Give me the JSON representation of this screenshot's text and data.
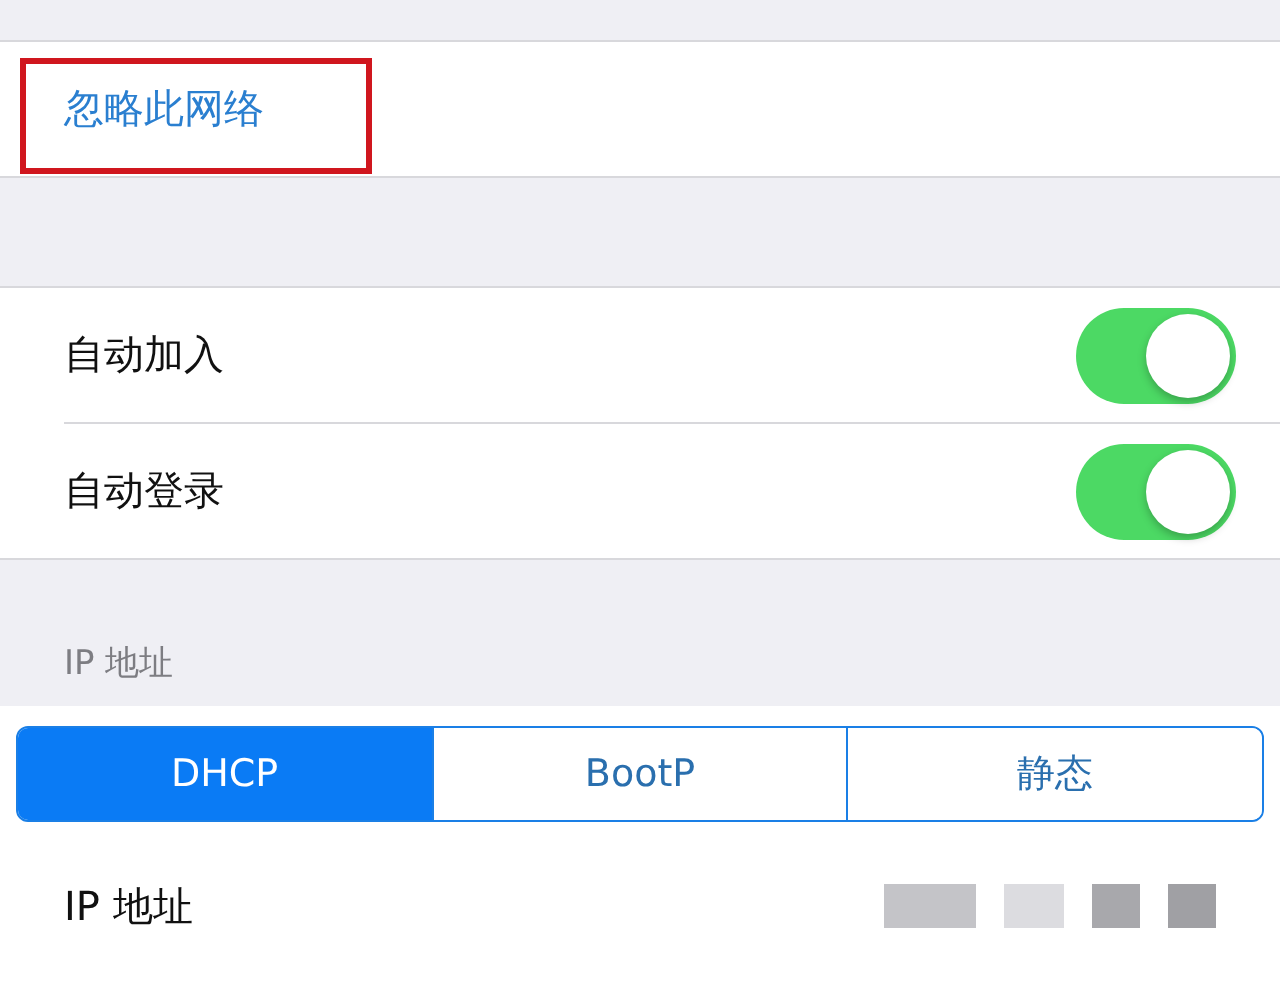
{
  "forget_network": {
    "label": "忽略此网络",
    "highlighted": true
  },
  "toggles": [
    {
      "label": "自动加入",
      "on": true
    },
    {
      "label": "自动登录",
      "on": true
    }
  ],
  "ip_section": {
    "header": "IP 地址",
    "segments": [
      {
        "label": "DHCP",
        "selected": true
      },
      {
        "label": "BootP",
        "selected": false
      },
      {
        "label": "静态",
        "selected": false
      }
    ],
    "rows": [
      {
        "label": "IP 地址",
        "redacted": true
      }
    ]
  }
}
